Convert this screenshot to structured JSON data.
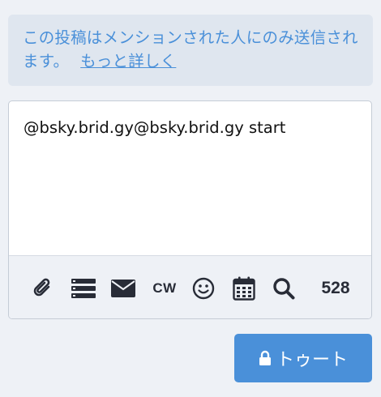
{
  "notice": {
    "text": "この投稿はメンションされた人にのみ送信されます。",
    "link_label": "もっと詳しく"
  },
  "compose": {
    "text": "@bsky.brid.gy@bsky.brid.gy start"
  },
  "toolbar": {
    "attach_icon": "paperclip-icon",
    "poll_icon": "poll-icon",
    "visibility_icon": "envelope-icon",
    "cw_label": "CW",
    "emoji_icon": "smile-icon",
    "schedule_icon": "calendar-icon",
    "search_icon": "search-icon",
    "char_count": "528"
  },
  "submit": {
    "label": "トゥート",
    "icon": "lock-icon"
  },
  "colors": {
    "accent": "#4a90d9",
    "notice_bg": "#dfe6ef",
    "page_bg": "#eef1f6",
    "icon": "#282c37"
  }
}
